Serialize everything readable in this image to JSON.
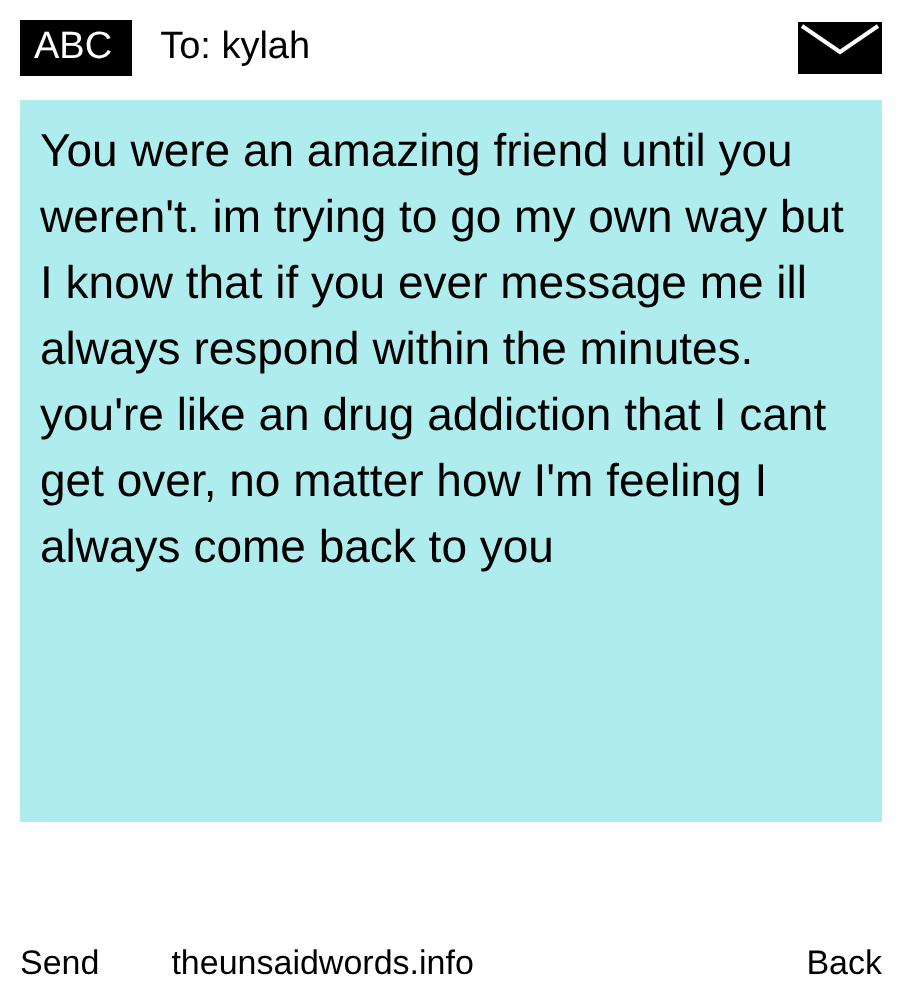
{
  "header": {
    "mode_badge": "ABC",
    "recipient": "To: kylah"
  },
  "message": {
    "text": "You were an amazing friend until you weren't. im trying to go my own way but I know that if you ever message me ill always respond within the minutes. you're like an drug addiction that I cant get over, no matter how I'm feeling I always come back to you"
  },
  "footer": {
    "left": "Send",
    "center": "theunsaidwords.info",
    "right": "Back"
  }
}
